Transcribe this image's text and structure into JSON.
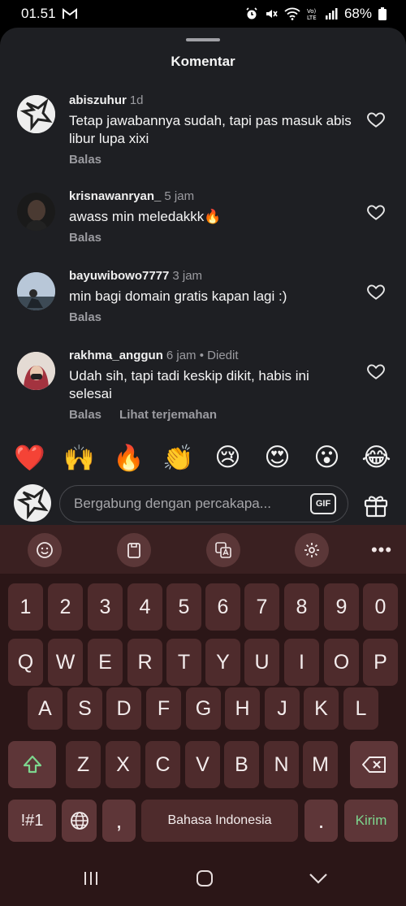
{
  "status_bar": {
    "time": "01.51",
    "battery": "68%",
    "icons": [
      "gmail-icon",
      "alarm-icon",
      "mute-icon",
      "wifi-icon",
      "volte-icon",
      "signal-icon",
      "battery-icon"
    ]
  },
  "sheet": {
    "title": "Komentar"
  },
  "comments": [
    {
      "user": "abiszuhur",
      "time": "1d",
      "edited": "",
      "text": "Tetap jawabannya sudah, tapi pas masuk abis libur lupa xixi",
      "reply": "Balas",
      "translate": ""
    },
    {
      "user": "krisnawanryan_",
      "time": "5 jam",
      "edited": "",
      "text": "awass min meledakkk🔥",
      "reply": "Balas",
      "translate": ""
    },
    {
      "user": "bayuwibowo7777",
      "time": "3 jam",
      "edited": "",
      "text": "min bagi domain gratis kapan lagi :)",
      "reply": "Balas",
      "translate": ""
    },
    {
      "user": "rakhma_anggun",
      "time": "6 jam",
      "edited": "• Diedit",
      "text": "Udah sih, tapi tadi keskip dikit, habis ini selesai",
      "reply": "Balas",
      "translate": "Lihat terjemahan"
    }
  ],
  "emoji_bar": [
    "❤️",
    "🙌",
    "🔥",
    "👏",
    "😢",
    "😍",
    "😮",
    "😂"
  ],
  "composer": {
    "placeholder": "Bergabung dengan percakapa...",
    "gif_label": "GIF"
  },
  "keyboard": {
    "toolbar_icons": [
      "emoji-icon",
      "clipboard-icon",
      "translate-icon",
      "settings-icon",
      "more-icon"
    ],
    "more_label": "•••",
    "row_numbers": [
      "1",
      "2",
      "3",
      "4",
      "5",
      "6",
      "7",
      "8",
      "9",
      "0"
    ],
    "row_q": [
      "Q",
      "W",
      "E",
      "R",
      "T",
      "Y",
      "U",
      "I",
      "O",
      "P"
    ],
    "row_a": [
      "A",
      "S",
      "D",
      "F",
      "G",
      "H",
      "J",
      "K",
      "L"
    ],
    "row_z": [
      "Z",
      "X",
      "C",
      "V",
      "B",
      "N",
      "M"
    ],
    "symbols_label": "!#1",
    "comma_label": ",",
    "space_label": "Bahasa Indonesia",
    "period_label": ".",
    "send_label": "Kirim",
    "accent_color": "#7dd68e"
  },
  "navigation": {
    "icons": [
      "recent-apps-icon",
      "home-icon",
      "back-icon"
    ]
  }
}
